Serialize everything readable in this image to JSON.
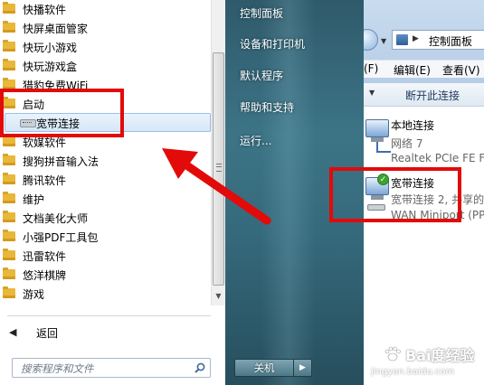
{
  "programs": [
    {
      "label": "快播软件",
      "type": "folder"
    },
    {
      "label": "快屏桌面管家",
      "type": "folder"
    },
    {
      "label": "快玩小游戏",
      "type": "folder"
    },
    {
      "label": "快玩游戏盒",
      "type": "folder"
    },
    {
      "label": "猎豹免费WiFi",
      "type": "folder"
    },
    {
      "label": "启动",
      "type": "folder"
    },
    {
      "label": "宽带连接",
      "type": "shortcut",
      "selected": true
    },
    {
      "label": "软媒软件",
      "type": "folder"
    },
    {
      "label": "搜狗拼音输入法",
      "type": "folder"
    },
    {
      "label": "腾讯软件",
      "type": "folder"
    },
    {
      "label": "维护",
      "type": "folder"
    },
    {
      "label": "文档美化大师",
      "type": "folder"
    },
    {
      "label": "小强PDF工具包",
      "type": "folder"
    },
    {
      "label": "迅雷软件",
      "type": "folder"
    },
    {
      "label": "悠洋棋牌",
      "type": "folder"
    },
    {
      "label": "游戏",
      "type": "folder"
    }
  ],
  "back_label": "返回",
  "search_placeholder": "搜索程序和文件",
  "right_menu": [
    {
      "label": "控制面板"
    },
    {
      "label": "设备和打印机"
    },
    {
      "label": "默认程序"
    },
    {
      "label": "帮助和支持"
    },
    {
      "label": "运行..."
    }
  ],
  "shutdown_label": "关机",
  "shutdown_arrow": "▶",
  "window": {
    "address": "控制面板",
    "address_sep": "▶",
    "menus": [
      "(F)",
      "编辑(E)",
      "查看(V)"
    ],
    "toolbar_action": "断开此连接",
    "connections": [
      {
        "name": "本地连接",
        "line1": "网络 7",
        "line2": "Realtek PCIe FE Fa"
      },
      {
        "name": "宽带连接",
        "line1": "宽带连接 2, 共享的",
        "line2": "WAN Miniport (PP"
      }
    ]
  },
  "watermark": {
    "main": "Bai度经验",
    "sub": "jingyan.baidu.com"
  },
  "colors": {
    "highlight_box": "#e30a0a",
    "folder": "#e8b83a",
    "glass": "#3c7486"
  }
}
